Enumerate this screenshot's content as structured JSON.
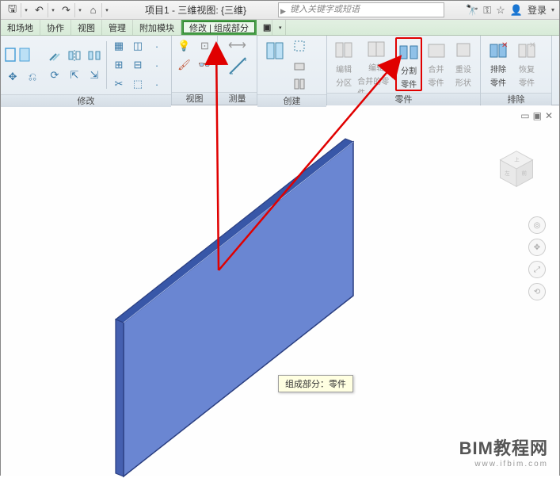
{
  "title": "项目1 - 三维视图: {三维}",
  "search_placeholder": "键入关键字或短语",
  "login_label": "登录",
  "tabs": [
    "和场地",
    "协作",
    "视图",
    "管理",
    "附加模块"
  ],
  "context_tab": "修改 | 组成部分",
  "ribbon": {
    "groups": [
      {
        "label": "修改"
      },
      {
        "label": "视图"
      },
      {
        "label": "测量"
      },
      {
        "label": "创建"
      },
      {
        "label": "零件"
      },
      {
        "label": "排除"
      }
    ],
    "parts": {
      "edit_partition": {
        "l1": "编辑",
        "l2": "分区"
      },
      "edit_merged": {
        "l1": "编辑",
        "l2": "合并的零件"
      },
      "split_parts": {
        "l1": "分割",
        "l2": "零件"
      },
      "merge_parts": {
        "l1": "合并",
        "l2": "零件"
      },
      "reset_shape": {
        "l1": "重设",
        "l2": "形状"
      },
      "exclude_parts": {
        "l1": "排除",
        "l2": "零件"
      },
      "restore_parts": {
        "l1": "恢复",
        "l2": "零件"
      }
    }
  },
  "tooltip": "组成部分：零件",
  "watermark": {
    "line1": "BIM教程网",
    "line2": "www.ifbim.com"
  }
}
